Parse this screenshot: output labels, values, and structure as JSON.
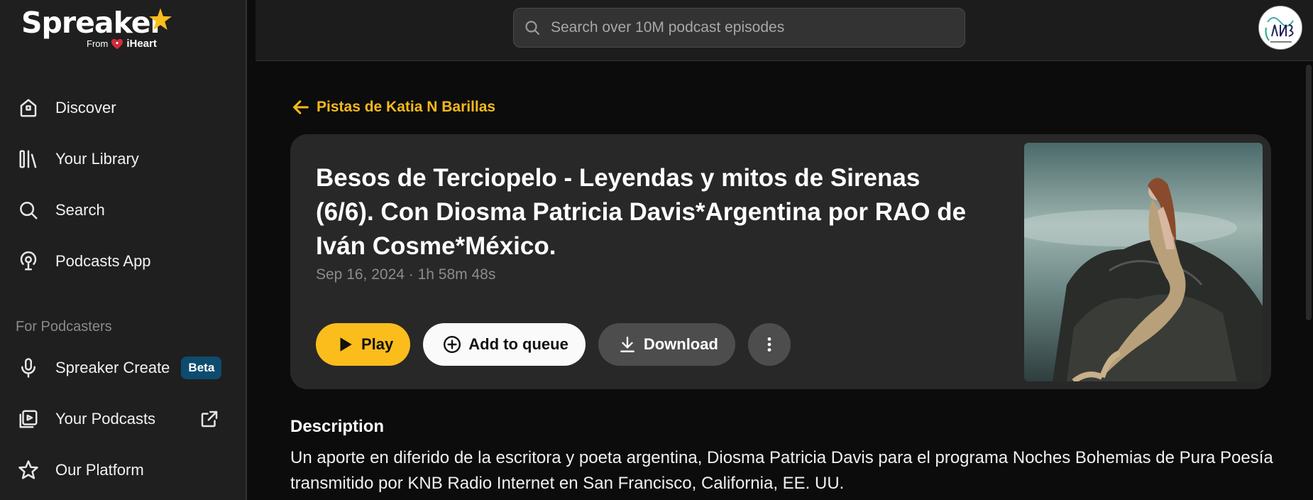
{
  "brand": {
    "name": "Spreaker",
    "from_label": "From",
    "parent": "iHeart",
    "accent_color": "#fbbd1c"
  },
  "sidebar": {
    "items": [
      {
        "label": "Discover",
        "icon": "discover-icon"
      },
      {
        "label": "Your Library",
        "icon": "library-icon"
      },
      {
        "label": "Search",
        "icon": "search-icon"
      },
      {
        "label": "Podcasts App",
        "icon": "podcasts-app-icon"
      }
    ],
    "section_label": "For Podcasters",
    "podcaster_items": [
      {
        "label": "Spreaker Create",
        "icon": "microphone-icon",
        "badge": "Beta"
      },
      {
        "label": "Your Podcasts",
        "icon": "your-podcasts-icon",
        "external": true
      },
      {
        "label": "Our Platform",
        "icon": "platform-star-icon"
      }
    ]
  },
  "header": {
    "search_placeholder": "Search over 10M podcast episodes"
  },
  "main": {
    "back_link": "Pistas de Katia N Barillas",
    "episode": {
      "title": "Besos de Terciopelo - Leyendas y mitos de Sirenas (6/6). Con Diosma Patricia Davis*Argentina por RAO de Iván Cosme*México.",
      "meta": "Sep 16, 2024 · 1h 58m 48s",
      "cover_icon": "mermaid-cover-image"
    },
    "actions": {
      "play": "Play",
      "queue": "Add to queue",
      "download": "Download"
    },
    "description_heading": "Description",
    "description": "Un aporte en diferido de la escritora y poeta argentina, Diosma Patricia Davis para el programa Noches Bohemias de Pura Poesía transmitido por KNB Radio Internet en San Francisco, California, EE. UU."
  }
}
